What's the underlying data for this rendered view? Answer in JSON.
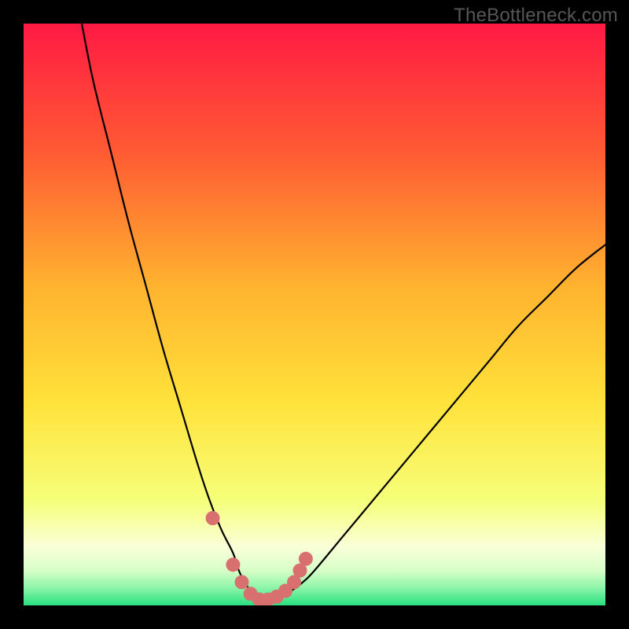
{
  "watermark": "TheBottleneck.com",
  "colors": {
    "page_bg": "#000000",
    "gradient_top": "#ff1a44",
    "gradient_mid1": "#ff8a2a",
    "gradient_mid2": "#ffe23a",
    "gradient_low": "#faffc0",
    "gradient_bottom": "#2fe88a",
    "curve": "#000000",
    "marker": "#d87070"
  },
  "chart_data": {
    "type": "line",
    "title": "",
    "xlabel": "",
    "ylabel": "",
    "xlim": [
      0,
      100
    ],
    "ylim": [
      0,
      100
    ],
    "series": [
      {
        "name": "bottleneck-curve",
        "x": [
          10,
          12,
          15,
          18,
          21,
          24,
          27,
          30,
          32,
          34,
          36,
          37,
          38,
          39,
          40,
          42,
          44,
          46,
          48,
          50,
          55,
          60,
          65,
          70,
          75,
          80,
          85,
          90,
          95,
          100
        ],
        "y": [
          100,
          90,
          78,
          66,
          55,
          44,
          34,
          24,
          18,
          13,
          9,
          6,
          4,
          2.5,
          1.5,
          1,
          1.5,
          2.5,
          4,
          6,
          12,
          18,
          24,
          30,
          36,
          42,
          48,
          53,
          58,
          62
        ]
      }
    ],
    "markers": {
      "name": "highlighted-points",
      "x": [
        32.5,
        36,
        37.5,
        39,
        40.5,
        42,
        43.5,
        45,
        46.5,
        47.5,
        48.5
      ],
      "y": [
        15,
        7,
        4,
        2,
        1,
        1,
        1.5,
        2.5,
        4,
        6,
        8
      ]
    }
  }
}
